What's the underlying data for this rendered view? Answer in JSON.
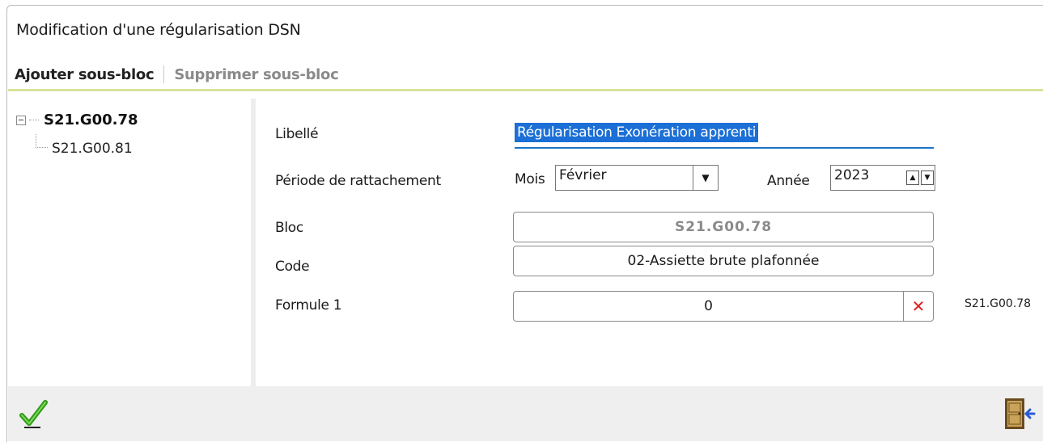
{
  "window": {
    "title": "Modification d'une régularisation DSN"
  },
  "toolbar": {
    "add_label": "Ajouter sous-bloc",
    "delete_label": "Supprimer sous-bloc"
  },
  "tree": {
    "root": {
      "label": "S21.G00.78",
      "icon": "collapse-icon"
    },
    "children": [
      {
        "label": "S21.G00.81"
      }
    ]
  },
  "form": {
    "libelle": {
      "label": "Libellé",
      "value": "Régularisation Exonération apprenti"
    },
    "periode": {
      "label": "Période de  rattachement",
      "mois_label": "Mois",
      "mois_value": "Février",
      "annee_label": "Année",
      "annee_value": "2023"
    },
    "bloc": {
      "label": "Bloc",
      "value": "S21.G00.78"
    },
    "code": {
      "label": "Code",
      "value": "02-Assiette brute plafonnée"
    },
    "formule": {
      "label": "Formule 1",
      "value": "0",
      "ref": "S21.G00.78"
    }
  },
  "footer": {
    "validate_icon": "checkmark-icon",
    "exit_icon": "door-exit-icon"
  },
  "colors": {
    "accent_line": "#d6e39a",
    "selection": "#1b6fd6",
    "clear_red": "#e02020"
  }
}
